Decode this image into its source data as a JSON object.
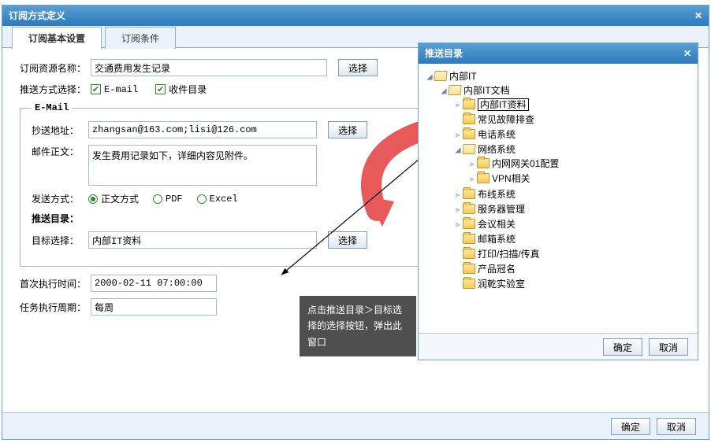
{
  "dialog": {
    "title": "订阅方式定义",
    "tabs": [
      "订阅基本设置",
      "订阅条件"
    ],
    "resource_label": "订阅资源名称：",
    "resource_value": "交通费用发生记录",
    "select_btn": "选择",
    "push_mode_label": "推送方式选择：",
    "chk_email": "E-mail",
    "chk_inbox": "收件目录",
    "email_section": "E-Mail",
    "cc_label": "抄送地址：",
    "cc_value": "zhangsan@163.com;lisi@126.com",
    "body_label": "邮件正文：",
    "body_value": "发生费用记录如下，详细内容见附件。",
    "send_mode_label": "发送方式：",
    "radio_text": "正文方式",
    "radio_pdf": "PDF",
    "radio_excel": "Excel",
    "push_dir_heading": "推送目录：",
    "target_label": "目标选择：",
    "target_value": "内部IT资料",
    "first_exec_label": "首次执行时间：",
    "first_exec_value": "2000-02-11 07:00:00",
    "task_cycle_label": "任务执行周期：",
    "task_cycle_value": "每周",
    "ok": "确定",
    "cancel": "取消"
  },
  "tooltip": "点击推送目录＞目标选择的选择按钮，弹出此窗口",
  "tree_dialog": {
    "title": "推送目录",
    "ok": "确定",
    "cancel": "取消"
  },
  "tree": {
    "root": "内部IT",
    "l1": "内部IT文档",
    "sel": "内部IT资料",
    "n1": "常见故障排查",
    "n2": "电话系统",
    "n3": "网络系统",
    "n3a": "内网网关01配置",
    "n3b": "VPN相关",
    "n4": "布线系统",
    "n5": "服务器管理",
    "n6": "会议相关",
    "n7": "邮箱系统",
    "n8": "打印/扫描/传真",
    "n9": "产品冠名",
    "n10": "润乾实验室"
  }
}
